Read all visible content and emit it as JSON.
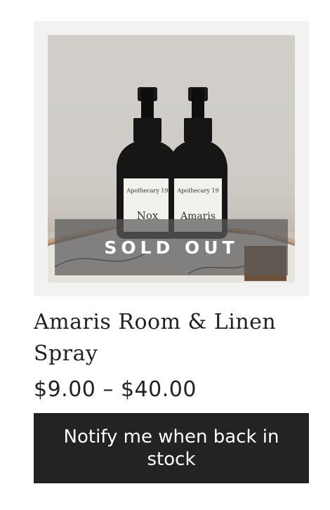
{
  "product": {
    "image_alt": "Two black spray bottles labeled Apothecary 19 Nox and Amaris",
    "badge": "SOLD OUT",
    "bottle_left": {
      "brand": "Apothecary 19",
      "name": "Nox"
    },
    "bottle_right": {
      "brand": "Apothecary 19",
      "name": "Amaris"
    },
    "title": "Amaris Room & Linen Spray",
    "price": "$9.00 – $40.00",
    "notify_label": "Notify me when back in stock"
  },
  "colors": {
    "button_bg": "#232323",
    "frame_bg": "#f2f2f2",
    "badge_overlay": "#5a5a5a"
  }
}
